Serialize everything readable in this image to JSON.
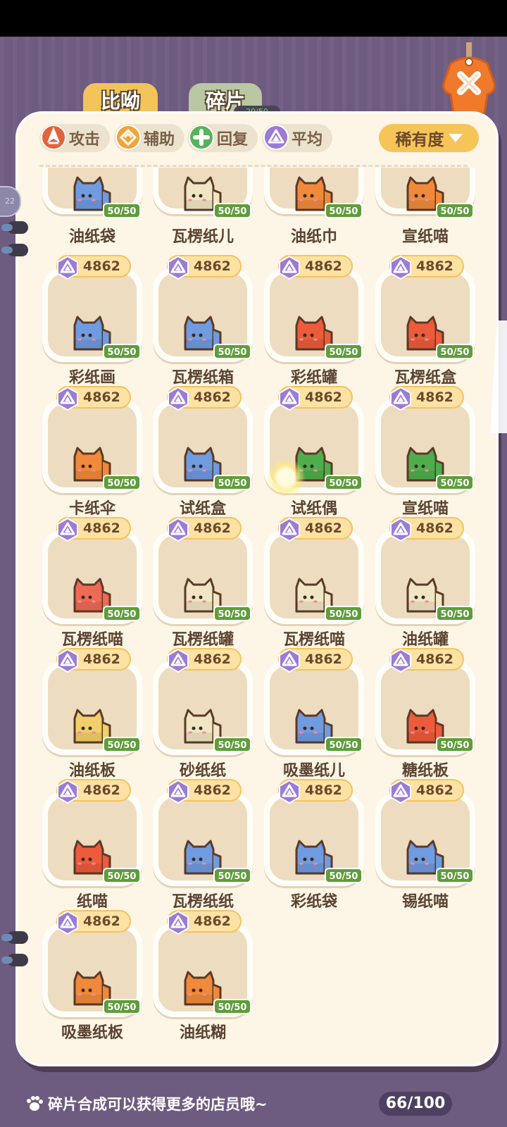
{
  "tabs": {
    "bihe": "比呦",
    "suipian": "碎片",
    "suipian_progress": "20/50"
  },
  "side_badge": "22",
  "filters": [
    {
      "label": "攻击",
      "icon": "attack-icon",
      "color": "#e0643c"
    },
    {
      "label": "辅助",
      "icon": "support-icon",
      "color": "#f2a33a"
    },
    {
      "label": "回复",
      "icon": "heal-icon",
      "color": "#58b25c"
    },
    {
      "label": "平均",
      "icon": "balance-icon",
      "color": "#9b7bd6"
    }
  ],
  "sort": {
    "label": "稀有度"
  },
  "first_row": [
    {
      "name": "油纸袋",
      "count": "50/50",
      "color": "#6f9be0"
    },
    {
      "name": "瓦楞纸儿",
      "count": "50/50",
      "color": "#f0e6c4"
    },
    {
      "name": "油纸巾",
      "count": "50/50",
      "color": "#f08a3a"
    },
    {
      "name": "宣纸喵",
      "count": "50/50",
      "color": "#f08a3a"
    }
  ],
  "cards": [
    {
      "name": "彩纸画",
      "cost": "4862",
      "count": "50/50",
      "color": "#6f9be0"
    },
    {
      "name": "瓦楞纸箱",
      "cost": "4862",
      "count": "50/50",
      "color": "#6f9be0"
    },
    {
      "name": "彩纸罐",
      "cost": "4862",
      "count": "50/50",
      "color": "#ee5b3a"
    },
    {
      "name": "瓦楞纸盒",
      "cost": "4862",
      "count": "50/50",
      "color": "#ee5b3a"
    },
    {
      "name": "卡纸伞",
      "cost": "4862",
      "count": "50/50",
      "color": "#f08a3a"
    },
    {
      "name": "试纸盒",
      "cost": "4862",
      "count": "50/50",
      "color": "#6f9be0"
    },
    {
      "name": "试纸偶",
      "cost": "4862",
      "count": "50/50",
      "color": "#4fae4c"
    },
    {
      "name": "宣纸喵",
      "cost": "4862",
      "count": "50/50",
      "color": "#4fae4c"
    },
    {
      "name": "瓦楞纸喵",
      "cost": "4862",
      "count": "50/50",
      "color": "#ef6a55"
    },
    {
      "name": "瓦楞纸罐",
      "cost": "4862",
      "count": "50/50",
      "color": "#f0e6c4"
    },
    {
      "name": "瓦楞纸喵",
      "cost": "4862",
      "count": "50/50",
      "color": "#f0e6c4"
    },
    {
      "name": "油纸罐",
      "cost": "4862",
      "count": "50/50",
      "color": "#f0e6c4"
    },
    {
      "name": "油纸板",
      "cost": "4862",
      "count": "50/50",
      "color": "#f1cf6a"
    },
    {
      "name": "砂纸纸",
      "cost": "4862",
      "count": "50/50",
      "color": "#f0e6c4"
    },
    {
      "name": "吸墨纸儿",
      "cost": "4862",
      "count": "50/50",
      "color": "#6f9be0"
    },
    {
      "name": "糖纸板",
      "cost": "4862",
      "count": "50/50",
      "color": "#ee5b3a"
    },
    {
      "name": "纸喵",
      "cost": "4862",
      "count": "50/50",
      "color": "#ee5b3a"
    },
    {
      "name": "瓦楞纸纸",
      "cost": "4862",
      "count": "50/50",
      "color": "#6f9be0"
    },
    {
      "name": "彩纸袋",
      "cost": "4862",
      "count": "50/50",
      "color": "#6f9be0"
    },
    {
      "name": "锡纸喵",
      "cost": "4862",
      "count": "50/50",
      "color": "#6f9be0"
    },
    {
      "name": "吸墨纸板",
      "cost": "4862",
      "count": "50/50",
      "color": "#f08a3a"
    },
    {
      "name": "油纸糊",
      "cost": "4862",
      "count": "50/50",
      "color": "#f08a3a"
    }
  ],
  "footer": {
    "tip": "碎片合成可以获得更多的店员哦~",
    "capacity": "66/100"
  }
}
